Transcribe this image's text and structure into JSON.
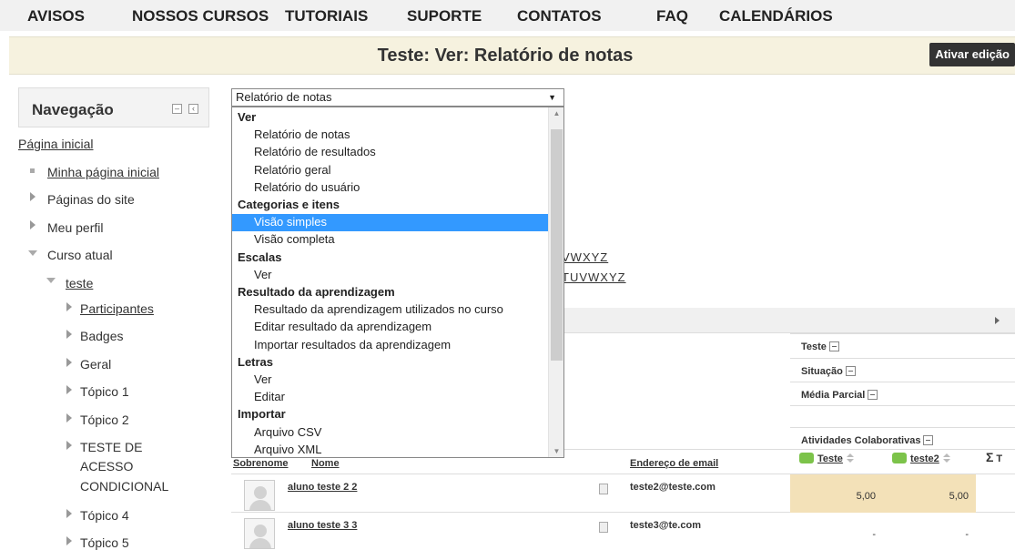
{
  "topnav": {
    "items": [
      "AVISOS",
      "NOSSOS CURSOS",
      "TUTORIAIS",
      "SUPORTE",
      "CONTATOS",
      "FAQ",
      "CALENDÁRIOS"
    ]
  },
  "header": {
    "title": "Teste: Ver: Relatório de notas",
    "edit_button": "Ativar edição"
  },
  "navigation": {
    "title": "Navegação",
    "home": "Página inicial",
    "my_home": "Minha página inicial",
    "site_pages": "Páginas do site",
    "my_profile": "Meu perfil",
    "current_course": "Curso atual",
    "course": "teste",
    "participants": "Participantes",
    "badges": "Badges",
    "general": "Geral",
    "topic1": "Tópico 1",
    "topic2": "Tópico 2",
    "conditional_l1": "TESTE DE",
    "conditional_l2": "ACESSO",
    "conditional_l3": "CONDICIONAL",
    "topic4": "Tópico 4",
    "topic5": "Tópico 5"
  },
  "report_select": {
    "selected": "Relatório de notas",
    "options": [
      {
        "label": "Ver",
        "group": true
      },
      {
        "label": "Relatório de notas"
      },
      {
        "label": "Relatório de resultados"
      },
      {
        "label": "Relatório geral"
      },
      {
        "label": "Relatório do usuário"
      },
      {
        "label": "Categorias e itens",
        "group": true
      },
      {
        "label": "Visão simples",
        "selected": true
      },
      {
        "label": "Visão completa"
      },
      {
        "label": "Escalas",
        "group": true
      },
      {
        "label": "Ver"
      },
      {
        "label": "Resultado da aprendizagem",
        "group": true
      },
      {
        "label": "Resultado da aprendizagem utilizados no curso"
      },
      {
        "label": "Editar resultado da aprendizagem"
      },
      {
        "label": "Importar resultados da aprendizagem"
      },
      {
        "label": "Letras",
        "group": true
      },
      {
        "label": "Ver"
      },
      {
        "label": "Editar"
      },
      {
        "label": "Importar",
        "group": true
      },
      {
        "label": "Arquivo CSV"
      },
      {
        "label": "Arquivo XML"
      }
    ]
  },
  "letter_filters": {
    "row1": "VWXYZ",
    "row2": "TUVWXYZ"
  },
  "categories": {
    "course": "Teste",
    "situation": "Situação",
    "partial_avg": "Média Parcial",
    "collab": "Atividades Colaborativas"
  },
  "table": {
    "headers": {
      "surname": "Sobrenome",
      "name": "Nome",
      "email": "Endereço de email",
      "col_teste": "Teste",
      "col_teste2": "teste2",
      "col_total": "T"
    },
    "rows": [
      {
        "name": "aluno teste 2 2",
        "email": "teste2@teste.com",
        "g1": "5,00",
        "g2": "5,00"
      },
      {
        "name": "aluno teste 3 3",
        "email": "teste3@te.com",
        "g1": "-",
        "g2": "-"
      }
    ]
  }
}
